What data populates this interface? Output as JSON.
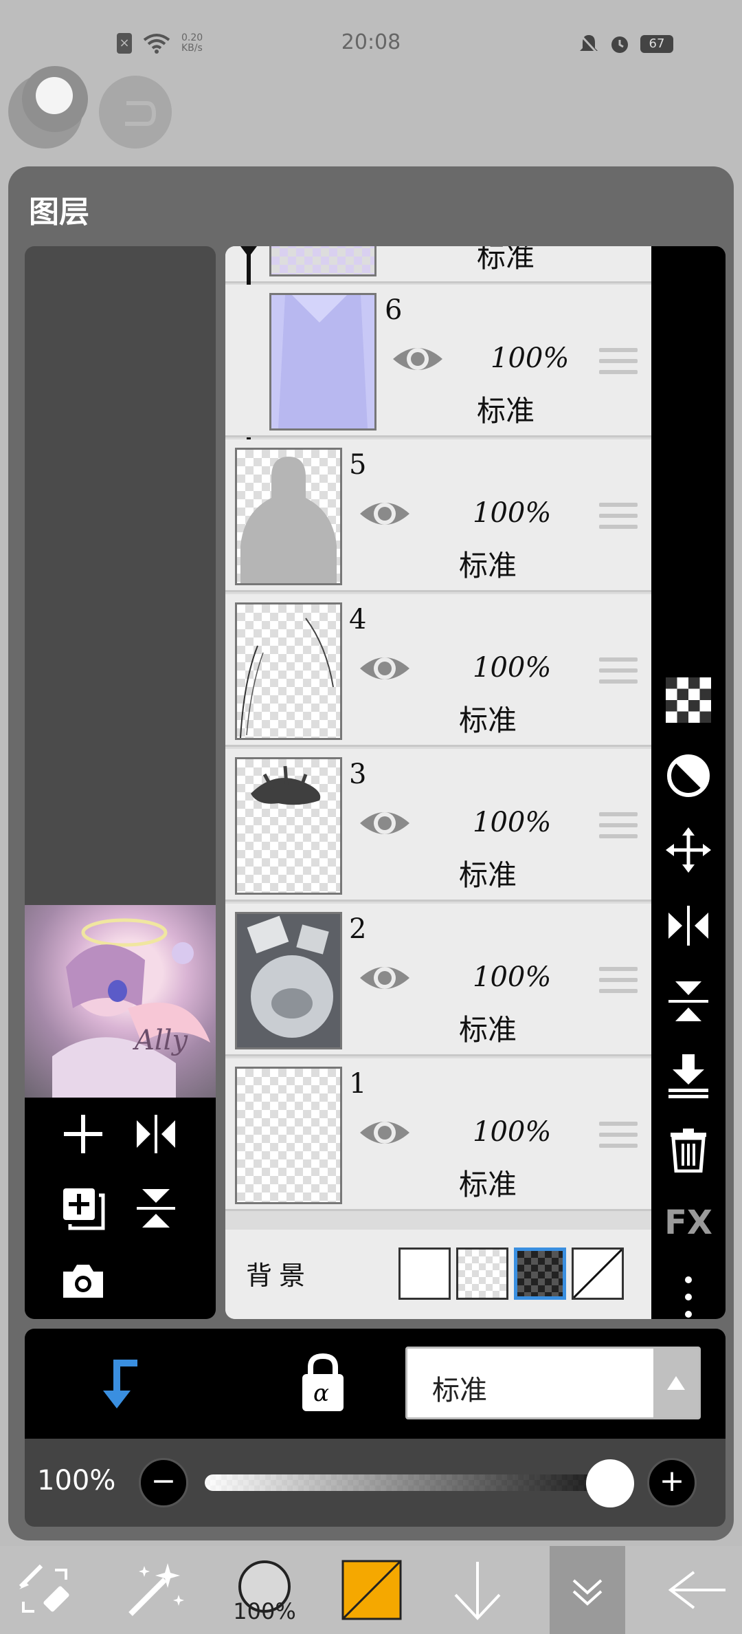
{
  "status_bar": {
    "speed_value": "0.20",
    "speed_unit": "KB/s",
    "time": "20:08",
    "battery": "67"
  },
  "panel": {
    "title": "图层"
  },
  "layers": {
    "top_partial": {
      "mode": "标准"
    },
    "items": [
      {
        "number": "6",
        "opacity": "100%",
        "mode": "标准"
      },
      {
        "number": "5",
        "opacity": "100%",
        "mode": "标准"
      },
      {
        "number": "4",
        "opacity": "100%",
        "mode": "标准"
      },
      {
        "number": "3",
        "opacity": "100%",
        "mode": "标准"
      },
      {
        "number": "2",
        "opacity": "100%",
        "mode": "标准"
      },
      {
        "number": "1",
        "opacity": "100%",
        "mode": "标准"
      }
    ],
    "background_label": "背景"
  },
  "right_tools": {
    "fx_label": "FX"
  },
  "blend": {
    "mode": "标准",
    "lock_label": "α"
  },
  "opacity": {
    "label": "100%",
    "value_fraction": 1.0,
    "minus": "−",
    "plus": "+"
  },
  "bottom_bar": {
    "brush_size_label": "100%",
    "color": "#f5a800"
  },
  "colors": {
    "accent_blue": "#3a8fe0",
    "panel_bg": "#6a6a6a"
  }
}
